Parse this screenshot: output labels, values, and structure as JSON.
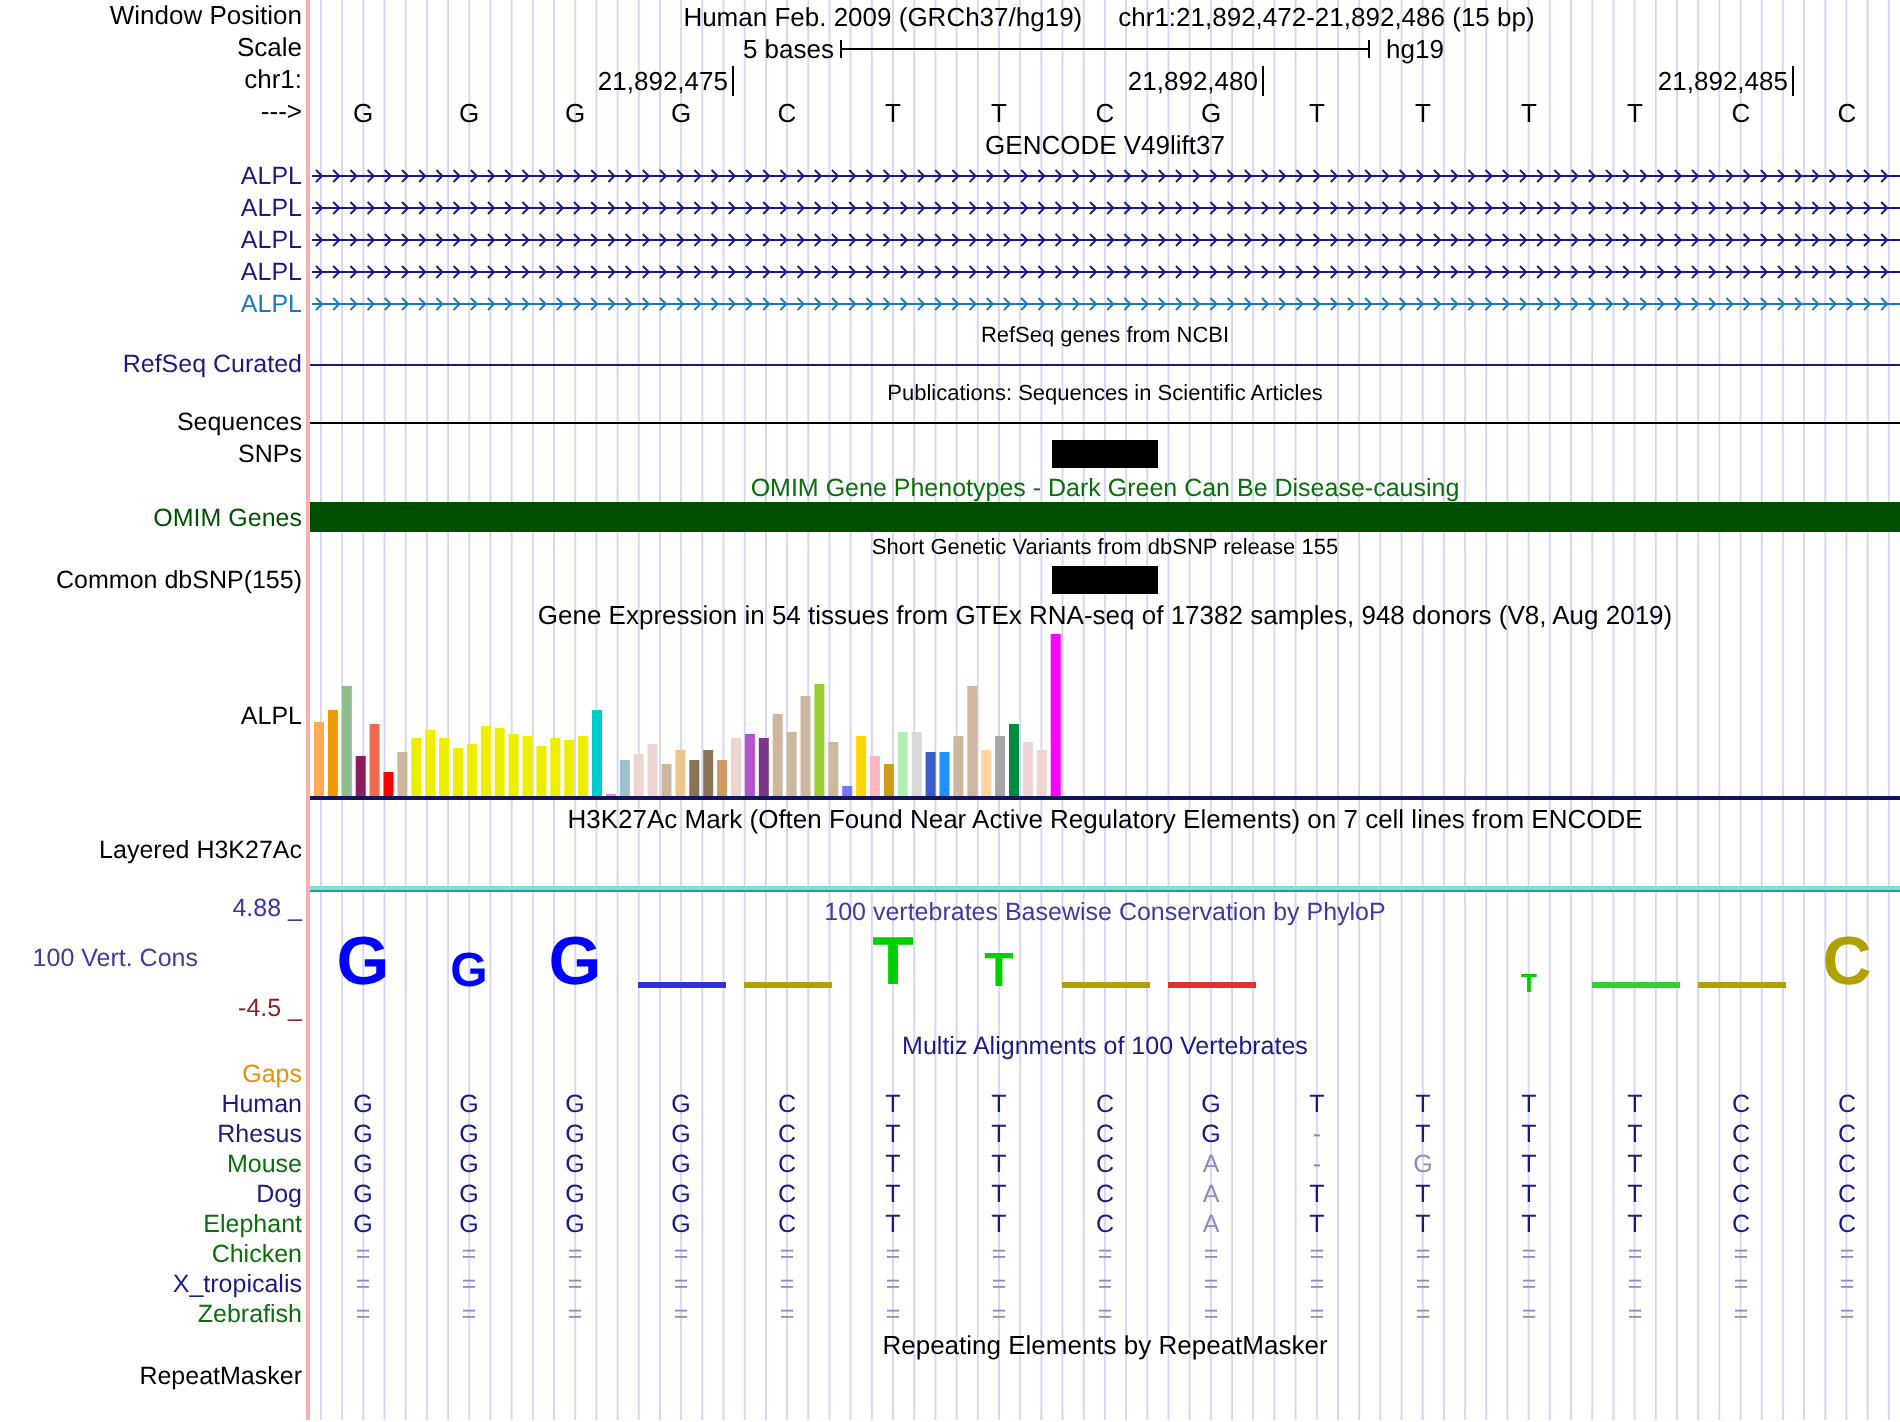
{
  "header": {
    "window_position_label": "Window Position",
    "assembly": "Human Feb. 2009 (GRCh37/hg19)",
    "position": "chr1:21,892,472-21,892,486 (15 bp)",
    "scale_label": "Scale",
    "scale_text": "5 bases",
    "scale_assembly": "hg19",
    "chrom_label": "chr1:",
    "strand_label": "--->",
    "bases": [
      {
        "base": "G"
      },
      {
        "base": "G"
      },
      {
        "base": "G"
      },
      {
        "base": "G",
        "tick": "21,892,475"
      },
      {
        "base": "C"
      },
      {
        "base": "T"
      },
      {
        "base": "T"
      },
      {
        "base": "C"
      },
      {
        "base": "G",
        "tick": "21,892,480"
      },
      {
        "base": "T"
      },
      {
        "base": "T"
      },
      {
        "base": "T"
      },
      {
        "base": "T"
      },
      {
        "base": "C",
        "tick": "21,892,485"
      },
      {
        "base": "C"
      }
    ]
  },
  "tracks": [
    {
      "kind": "genes",
      "title": "GENCODE V49lift37",
      "rows": [
        {
          "kind": "gene",
          "label": "ALPL",
          "color": "#1a1a80"
        },
        {
          "kind": "gene",
          "label": "ALPL",
          "color": "#1a1a80"
        },
        {
          "kind": "gene",
          "label": "ALPL",
          "color": "#1a1a80"
        },
        {
          "kind": "gene",
          "label": "ALPL",
          "color": "#1a1a80"
        },
        {
          "kind": "gene",
          "label": "ALPL",
          "color": "#1f78b4"
        }
      ]
    },
    {
      "kind": "small",
      "title": "RefSeq genes from NCBI",
      "rows": [
        {
          "kind": "line",
          "label": "RefSeq Curated",
          "color": "#1a1a80"
        }
      ]
    },
    {
      "kind": "small",
      "title": "Publications: Sequences in Scientific Articles",
      "rows": [
        {
          "kind": "line",
          "label": "Sequences",
          "color": "#000000"
        },
        {
          "kind": "block",
          "label": "SNPs",
          "color": "#000000"
        }
      ]
    },
    {
      "kind": "omim",
      "title": "OMIM Gene Phenotypes - Dark Green Can Be Disease-causing",
      "rows": [
        {
          "kind": "bar",
          "label": "OMIM Genes",
          "color": "#005000"
        }
      ]
    },
    {
      "kind": "small",
      "title": "Short Genetic Variants from dbSNP release 155",
      "rows": [
        {
          "kind": "block",
          "label": "Common dbSNP(155)",
          "color": "#000000"
        }
      ]
    },
    {
      "kind": "large",
      "title": "Gene Expression in 54 tissues from GTEx RNA-seq of 17382 samples, 948 donors (V8, Aug 2019)",
      "rows": [
        {
          "kind": "expression",
          "label": "ALPL",
          "color": "#000000"
        }
      ]
    },
    {
      "kind": "large",
      "title": "H3K27Ac Mark (Often Found Near Active Regulatory Elements) on 7 cell lines from ENCODE",
      "rows": [
        {
          "kind": "layered",
          "label": "Layered H3K27Ac",
          "color": "#000000"
        }
      ]
    },
    {
      "kind": "phylop",
      "title": "100 vertebrates Basewise Conservation by PhyloP",
      "rows": [
        {
          "kind": "logo",
          "label": "100 Vert. Cons",
          "color": "#3c3c9a",
          "max": "4.88 _",
          "min": "-4.5 _",
          "letters": [
            {
              "kind": "tall",
              "base": "G"
            },
            {
              "kind": "medium",
              "base": "G"
            },
            {
              "kind": "tall",
              "base": "G"
            },
            {
              "kind": "flat",
              "color": "#3030e0"
            },
            {
              "kind": "flat",
              "color": "#b0a000"
            },
            {
              "kind": "tall",
              "base": "T"
            },
            {
              "kind": "medium",
              "base": "T"
            },
            {
              "kind": "flat",
              "color": "#b0a000"
            },
            {
              "kind": "flat",
              "color": "#e03030"
            },
            {
              "kind": "none"
            },
            {
              "kind": "none"
            },
            {
              "kind": "small",
              "base": "T"
            },
            {
              "kind": "flat",
              "color": "#30d030"
            },
            {
              "kind": "flat",
              "color": "#b0a000"
            },
            {
              "kind": "tall",
              "base": "C"
            }
          ]
        }
      ]
    },
    {
      "kind": "multiz",
      "title": "Multiz Alignments of 100 Vertebrates",
      "rows": [
        {
          "kind": "gaps",
          "label": "Gaps",
          "color": "#e8900a"
        },
        {
          "kind": "align",
          "label": "Human",
          "color": "#1a1a80",
          "bases": [
            "G",
            "G",
            "G",
            "G",
            "C",
            "T",
            "T",
            "C",
            "G",
            "T",
            "T",
            "T",
            "T",
            "C",
            "C"
          ]
        },
        {
          "kind": "align",
          "label": "Rhesus",
          "color": "#1a1a80",
          "bases": [
            "G",
            "G",
            "G",
            "G",
            "C",
            "T",
            "T",
            "C",
            "G",
            "-",
            "T",
            "T",
            "T",
            "C",
            "C"
          ]
        },
        {
          "kind": "align",
          "label": "Mouse",
          "color": "#0a6e0a",
          "bases": [
            "G",
            "G",
            "G",
            "G",
            "C",
            "T",
            "T",
            "C",
            "A",
            "-",
            "G",
            "T",
            "T",
            "C",
            "C"
          ]
        },
        {
          "kind": "align",
          "label": "Dog",
          "color": "#1a1a80",
          "bases": [
            "G",
            "G",
            "G",
            "G",
            "C",
            "T",
            "T",
            "C",
            "A",
            "T",
            "T",
            "T",
            "T",
            "C",
            "C"
          ]
        },
        {
          "kind": "align",
          "label": "Elephant",
          "color": "#0a6e0a",
          "bases": [
            "G",
            "G",
            "G",
            "G",
            "C",
            "T",
            "T",
            "C",
            "A",
            "T",
            "T",
            "T",
            "T",
            "C",
            "C"
          ]
        },
        {
          "kind": "align",
          "label": "Chicken",
          "color": "#0a6e0a",
          "bases": [
            "=",
            "=",
            "=",
            "=",
            "=",
            "=",
            "=",
            "=",
            "=",
            "=",
            "=",
            "=",
            "=",
            "=",
            "="
          ]
        },
        {
          "kind": "align",
          "label": "X_tropicalis",
          "color": "#1a1a80",
          "bases": [
            "=",
            "=",
            "=",
            "=",
            "=",
            "=",
            "=",
            "=",
            "=",
            "=",
            "=",
            "=",
            "=",
            "=",
            "="
          ]
        },
        {
          "kind": "align",
          "label": "Zebrafish",
          "color": "#0a6e0a",
          "bases": [
            "=",
            "=",
            "=",
            "=",
            "=",
            "=",
            "=",
            "=",
            "=",
            "=",
            "=",
            "=",
            "=",
            "=",
            "="
          ]
        }
      ]
    },
    {
      "kind": "large",
      "title": "Repeating Elements by RepeatMasker",
      "rows": [
        {
          "kind": "empty",
          "label": "RepeatMasker",
          "color": "#000000"
        }
      ]
    }
  ]
}
